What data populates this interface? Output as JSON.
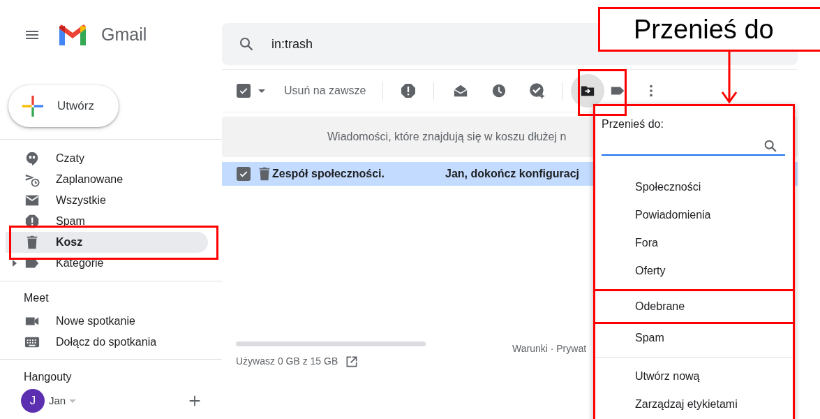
{
  "header": {
    "app_name": "Gmail",
    "search_query": "in:trash"
  },
  "compose_button": {
    "label": "Utwórz"
  },
  "sidebar": {
    "items": [
      {
        "label": "Czaty",
        "kind": "chat",
        "selected": false,
        "expandable": false
      },
      {
        "label": "Zaplanowane",
        "kind": "scheduled",
        "selected": false,
        "expandable": false
      },
      {
        "label": "Wszystkie",
        "kind": "mail",
        "selected": false,
        "expandable": false
      },
      {
        "label": "Spam",
        "kind": "spam",
        "selected": false,
        "expandable": false
      },
      {
        "label": "Kosz",
        "kind": "trash",
        "selected": true,
        "expandable": false
      },
      {
        "label": "Kategorie",
        "kind": "label",
        "selected": false,
        "expandable": true
      }
    ]
  },
  "meet": {
    "title": "Meet",
    "items": [
      {
        "label": "Nowe spotkanie",
        "kind": "video"
      },
      {
        "label": "Dołącz do spotkania",
        "kind": "keyboard"
      }
    ]
  },
  "hangouts": {
    "title": "Hangouty",
    "user": {
      "initial": "J",
      "name": "Jan"
    }
  },
  "toolbar": {
    "select_all_checked": true,
    "delete_forever": "Usuń na zawsze"
  },
  "banner": "Wiadomości, które znajdują się w koszu dłużej n",
  "messages": [
    {
      "sender": "Zespół społeczności.",
      "subject": "Jan, dokończ konfiguracj",
      "checked": true,
      "selected": true
    }
  ],
  "storage": {
    "text": "Używasz 0 GB z 15 GB"
  },
  "footer": "Warunki · Prywat",
  "move_menu": {
    "title": "Przenieś do:",
    "groups": [
      [
        "Społeczności",
        "Powiadomienia",
        "Fora",
        "Oferty"
      ],
      [
        "Odebrane",
        "Spam"
      ],
      [
        "Utwórz nową",
        "Zarządzaj etykietami"
      ]
    ]
  },
  "annotation": {
    "callout": "Przenieś do"
  }
}
